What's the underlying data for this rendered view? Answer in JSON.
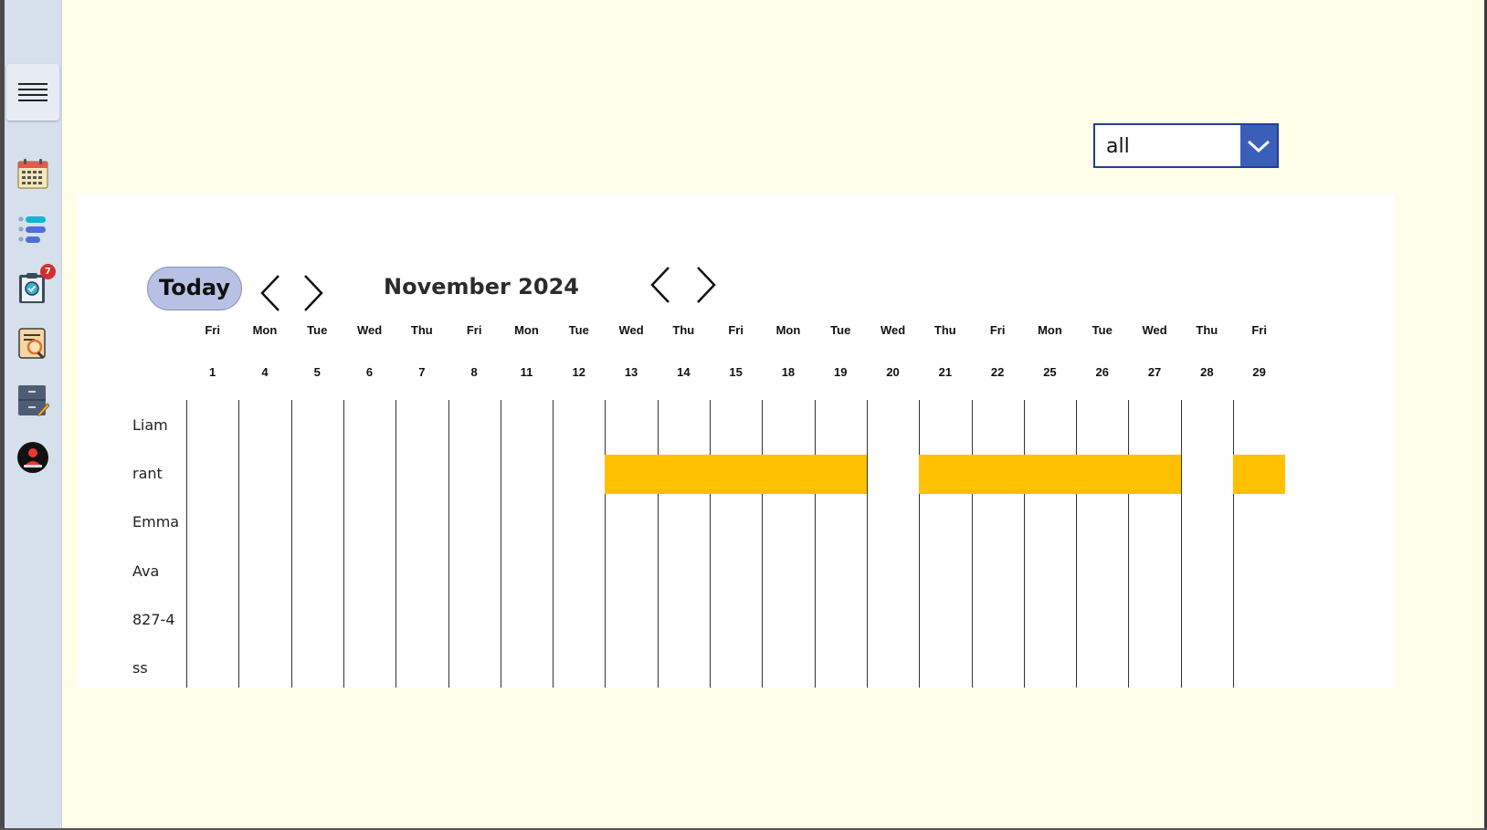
{
  "sidebar": {
    "menu_icon": "hamburger-menu-icon",
    "items": [
      {
        "icon": "calendar-icon",
        "badge": ""
      },
      {
        "icon": "task-list-icon",
        "badge": ""
      },
      {
        "icon": "clipboard-check-icon",
        "badge": "7"
      },
      {
        "icon": "document-search-icon",
        "badge": ""
      },
      {
        "icon": "cabinet-edit-icon",
        "badge": ""
      },
      {
        "icon": "user-profile-icon",
        "badge": ""
      }
    ]
  },
  "filter": {
    "value": "all"
  },
  "calendar": {
    "today_label": "Today",
    "month_title": "November 2024",
    "columns": [
      {
        "dow": "Fri",
        "day": "1"
      },
      {
        "dow": "Mon",
        "day": "4"
      },
      {
        "dow": "Tue",
        "day": "5"
      },
      {
        "dow": "Wed",
        "day": "6"
      },
      {
        "dow": "Thu",
        "day": "7"
      },
      {
        "dow": "Fri",
        "day": "8"
      },
      {
        "dow": "Mon",
        "day": "11"
      },
      {
        "dow": "Tue",
        "day": "12"
      },
      {
        "dow": "Wed",
        "day": "13"
      },
      {
        "dow": "Thu",
        "day": "14"
      },
      {
        "dow": "Fri",
        "day": "15"
      },
      {
        "dow": "Mon",
        "day": "18"
      },
      {
        "dow": "Tue",
        "day": "19"
      },
      {
        "dow": "Wed",
        "day": "20"
      },
      {
        "dow": "Thu",
        "day": "21"
      },
      {
        "dow": "Fri",
        "day": "22"
      },
      {
        "dow": "Mon",
        "day": "25"
      },
      {
        "dow": "Tue",
        "day": "26"
      },
      {
        "dow": "Wed",
        "day": "27"
      },
      {
        "dow": "Thu",
        "day": "28"
      },
      {
        "dow": "Fri",
        "day": "29"
      }
    ],
    "people": [
      "Liam",
      "rant",
      "Emma",
      "Ava",
      "827-4",
      "ss"
    ],
    "bookings": [
      {
        "person": "rant",
        "days": [
          "13",
          "14",
          "15",
          "18",
          "19"
        ]
      },
      {
        "person": "rant",
        "days": [
          "21",
          "22",
          "25",
          "26",
          "27"
        ]
      },
      {
        "person": "rant",
        "days": [
          "29"
        ]
      }
    ],
    "bar_color": "#ffc000"
  },
  "colors": {
    "accent": "#3a5fb8",
    "today_button": "#b6c1e4",
    "background": "#fefee9"
  }
}
